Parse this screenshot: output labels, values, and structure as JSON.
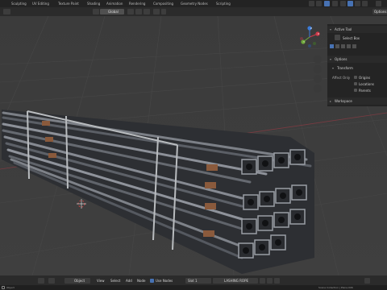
{
  "workspaces": [
    "Sculpting",
    "UV Editing",
    "Texture Paint",
    "Shading",
    "Animation",
    "Rendering",
    "Compositing",
    "Geometry Nodes",
    "Scripting"
  ],
  "header": {
    "transform_orientation": "Global",
    "options_label": "Options"
  },
  "npanel": {
    "active_tool_title": "Active Tool",
    "tool_name": "Select Box",
    "options_title": "Options",
    "transform_title": "Transform",
    "affect_only_label": "Affect Only",
    "origins_label": "Origins",
    "locations_label": "Locations",
    "parents_label": "Parents",
    "workspace_title": "Workspace"
  },
  "navigation_gizmo": {
    "axis_x": "X",
    "axis_y": "Y",
    "axis_z": "Z"
  },
  "bottom": {
    "editor_mode": "Object",
    "menu_view": "View",
    "menu_select": "Select",
    "menu_add": "Add",
    "menu_node": "Node",
    "use_nodes_label": "Use Nodes",
    "slot_label": "Slot 1",
    "material_name": "LASHING ROPE"
  },
  "status": {
    "left_text": "Object",
    "right_text": "Scene Collection | Plane.006"
  },
  "colors": {
    "accent_blue": "#4772b3",
    "axis_x_red": "#d03a4a",
    "axis_y_green": "#6ea83a",
    "axis_z_blue": "#3b7bd8"
  }
}
